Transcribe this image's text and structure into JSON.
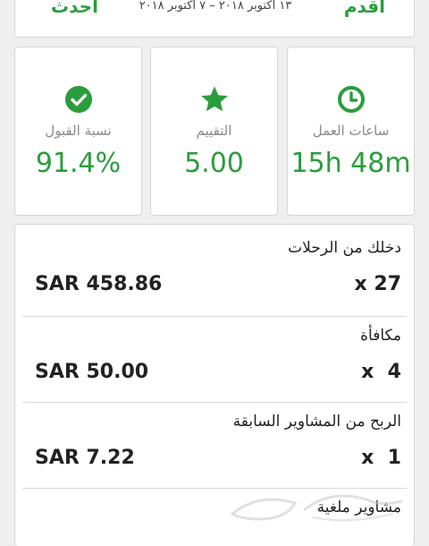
{
  "nav": {
    "prev_label": "أقدم",
    "next_label": "أحدث",
    "date_range": "١٣ أكتوبر ٢٠١٨ – ٧ أكتوبر ٢٠١٨"
  },
  "stats": {
    "acceptance": {
      "label": "نسبة القبول",
      "value": "91.4%",
      "icon": "check-circle-icon"
    },
    "rating": {
      "label": "التقييم",
      "value": "5.00",
      "icon": "star-icon"
    },
    "hours": {
      "label": "ساعات العمل",
      "value": "15h 48m",
      "icon": "clock-icon"
    }
  },
  "earnings": {
    "trips": {
      "title": "دخلك من الرحلات",
      "amount": "SAR 458.86",
      "count": "x 27"
    },
    "bonus": {
      "title": "مكافأة",
      "amount": "SAR 50.00",
      "count": "x  4"
    },
    "previous": {
      "title": "الربح من المشاوير السابقة",
      "amount": "SAR 7.22",
      "count": "x  1"
    },
    "cancelled": {
      "title": "مشاوير ملغية"
    }
  },
  "colors": {
    "accent": "#2a9d3d",
    "background": "#efefef",
    "card": "#ffffff"
  }
}
